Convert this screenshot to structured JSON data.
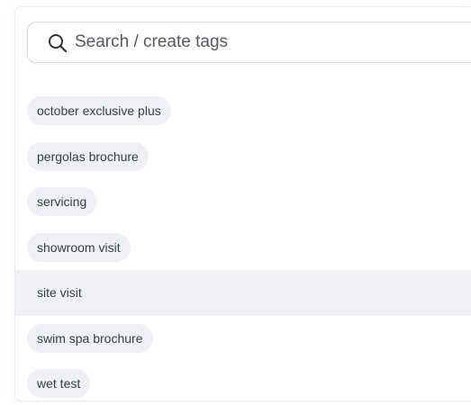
{
  "search": {
    "placeholder": "Search / create tags",
    "value": "",
    "icon": "search-icon"
  },
  "tags": [
    {
      "label": "october exclusive plus",
      "highlighted": false
    },
    {
      "label": "pergolas brochure",
      "highlighted": false
    },
    {
      "label": "servicing",
      "highlighted": false
    },
    {
      "label": "showroom visit",
      "highlighted": false
    },
    {
      "label": "site visit",
      "highlighted": true
    },
    {
      "label": "swim spa brochure",
      "highlighted": false
    },
    {
      "label": "wet test",
      "highlighted": false
    }
  ],
  "colors": {
    "pill_background": "#eef0f4",
    "highlight_row": "#f0f1f4",
    "text": "#3a3d44"
  }
}
